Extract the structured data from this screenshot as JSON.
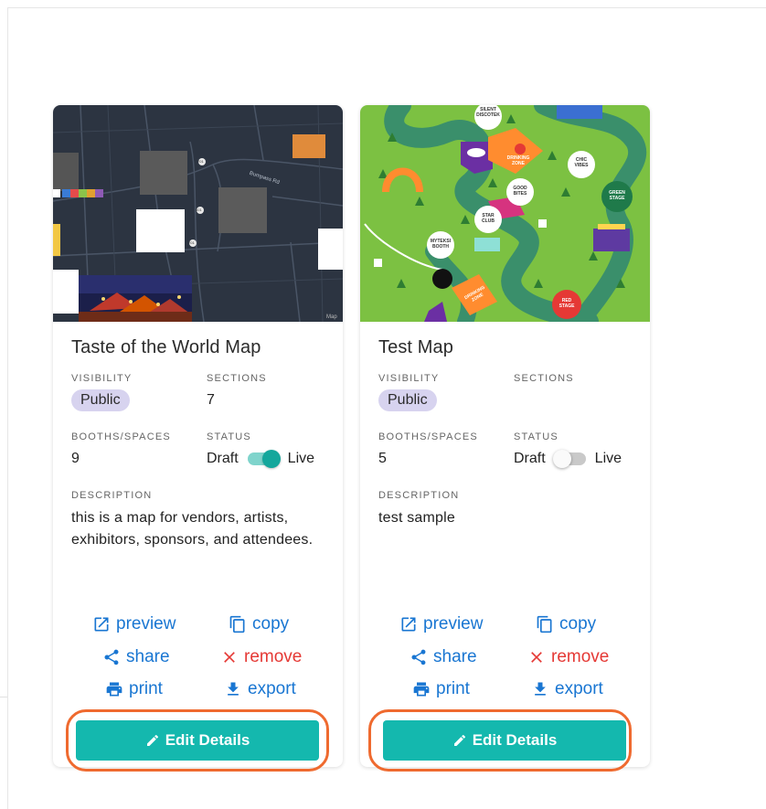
{
  "cards": [
    {
      "title": "Taste of the World Map",
      "visibility_label": "VISIBILITY",
      "visibility_value": "Public",
      "sections_label": "SECTIONS",
      "sections_value": "7",
      "booths_label": "BOOTHS/SPACES",
      "booths_value": "9",
      "status_label": "STATUS",
      "status_off": "Draft",
      "status_on": "Live",
      "status_live": true,
      "description_label": "DESCRIPTION",
      "description": "this is a map for vendors, artists, exhibitors, sponsors, and attendees.",
      "map_labels": {
        "road": "Bumpass Rd",
        "r1": "701",
        "r2": "501",
        "r3": "701",
        "credit": "Map"
      },
      "actions": {
        "preview": "preview",
        "copy": "copy",
        "share": "share",
        "remove": "remove",
        "print": "print",
        "export": "export"
      },
      "edit_label": "Edit Details"
    },
    {
      "title": "Test Map",
      "visibility_label": "VISIBILITY",
      "visibility_value": "Public",
      "sections_label": "SECTIONS",
      "sections_value": "",
      "booths_label": "BOOTHS/SPACES",
      "booths_value": "5",
      "status_label": "STATUS",
      "status_off": "Draft",
      "status_on": "Live",
      "status_live": false,
      "description_label": "DESCRIPTION",
      "description": "test sample",
      "map_labels": {
        "silent": "SILENT DISCOTEK",
        "drinking": "DRINKING ZONE",
        "chic": "CHIC VIBES",
        "green": "GREEN STAGE",
        "good": "GOOD BITES",
        "star": "STAR CLUB",
        "myteksi": "MYTEKSI BOOTH",
        "red": "RED STAGE",
        "drinking2": "DRINKING ZONE"
      },
      "actions": {
        "preview": "preview",
        "copy": "copy",
        "share": "share",
        "remove": "remove",
        "print": "print",
        "export": "export"
      },
      "edit_label": "Edit Details"
    }
  ],
  "colors": {
    "accent": "#14b8ae",
    "link": "#1976d2",
    "danger": "#e53935",
    "badge": "#d7d3ef",
    "highlight": "#ef6a2f"
  }
}
